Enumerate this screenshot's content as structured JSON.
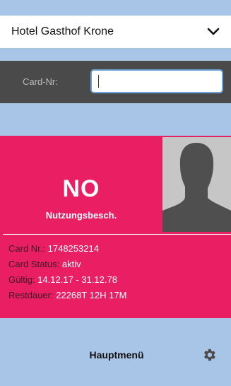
{
  "hotel_selector": {
    "selected": "Hotel Gasthof Krone",
    "icon": "chevron-down-icon"
  },
  "card_input": {
    "label": "Card-Nr:",
    "value": ""
  },
  "status": {
    "headline": "NO",
    "subtitle": "Nutzungsbesch.",
    "color": "#e91e63"
  },
  "details": [
    {
      "label": "Card Nr.:",
      "value": "1748253214"
    },
    {
      "label": "Card Status:",
      "value": "aktiv"
    },
    {
      "label": "Gültig:",
      "value": "14.12.17 - 31.12.78"
    },
    {
      "label": "Restdauer:",
      "value": "22268T 12H 17M"
    }
  ],
  "footer": {
    "menu_label": "Hauptmenü",
    "settings_icon": "gear-icon"
  }
}
